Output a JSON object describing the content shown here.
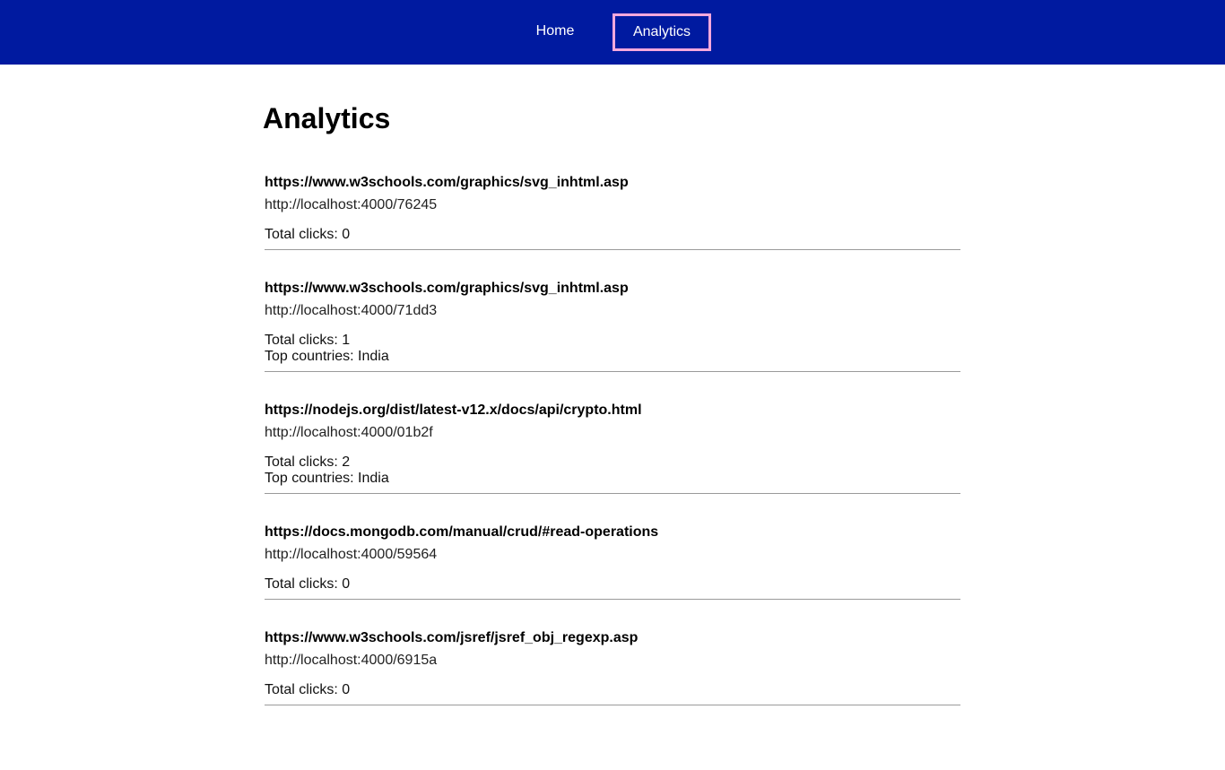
{
  "nav": {
    "home_label": "Home",
    "analytics_label": "Analytics",
    "active_outline_color": "#f6a8dc",
    "background_color": "#001aa0"
  },
  "page": {
    "title": "Analytics"
  },
  "items": [
    {
      "long_url": "https://www.w3schools.com/graphics/svg_inhtml.asp",
      "short_url": "http://localhost:4000/76245",
      "total_clicks": "Total clicks: 0"
    },
    {
      "long_url": "https://www.w3schools.com/graphics/svg_inhtml.asp",
      "short_url": "http://localhost:4000/71dd3",
      "total_clicks": "Total clicks: 1",
      "top_countries": "Top countries: India"
    },
    {
      "long_url": "https://nodejs.org/dist/latest-v12.x/docs/api/crypto.html",
      "short_url": "http://localhost:4000/01b2f",
      "total_clicks": "Total clicks: 2",
      "top_countries": "Top countries: India"
    },
    {
      "long_url": "https://docs.mongodb.com/manual/crud/#read-operations",
      "short_url": "http://localhost:4000/59564",
      "total_clicks": "Total clicks: 0"
    },
    {
      "long_url": "https://www.w3schools.com/jsref/jsref_obj_regexp.asp",
      "short_url": "http://localhost:4000/6915a",
      "total_clicks": "Total clicks: 0"
    }
  ]
}
